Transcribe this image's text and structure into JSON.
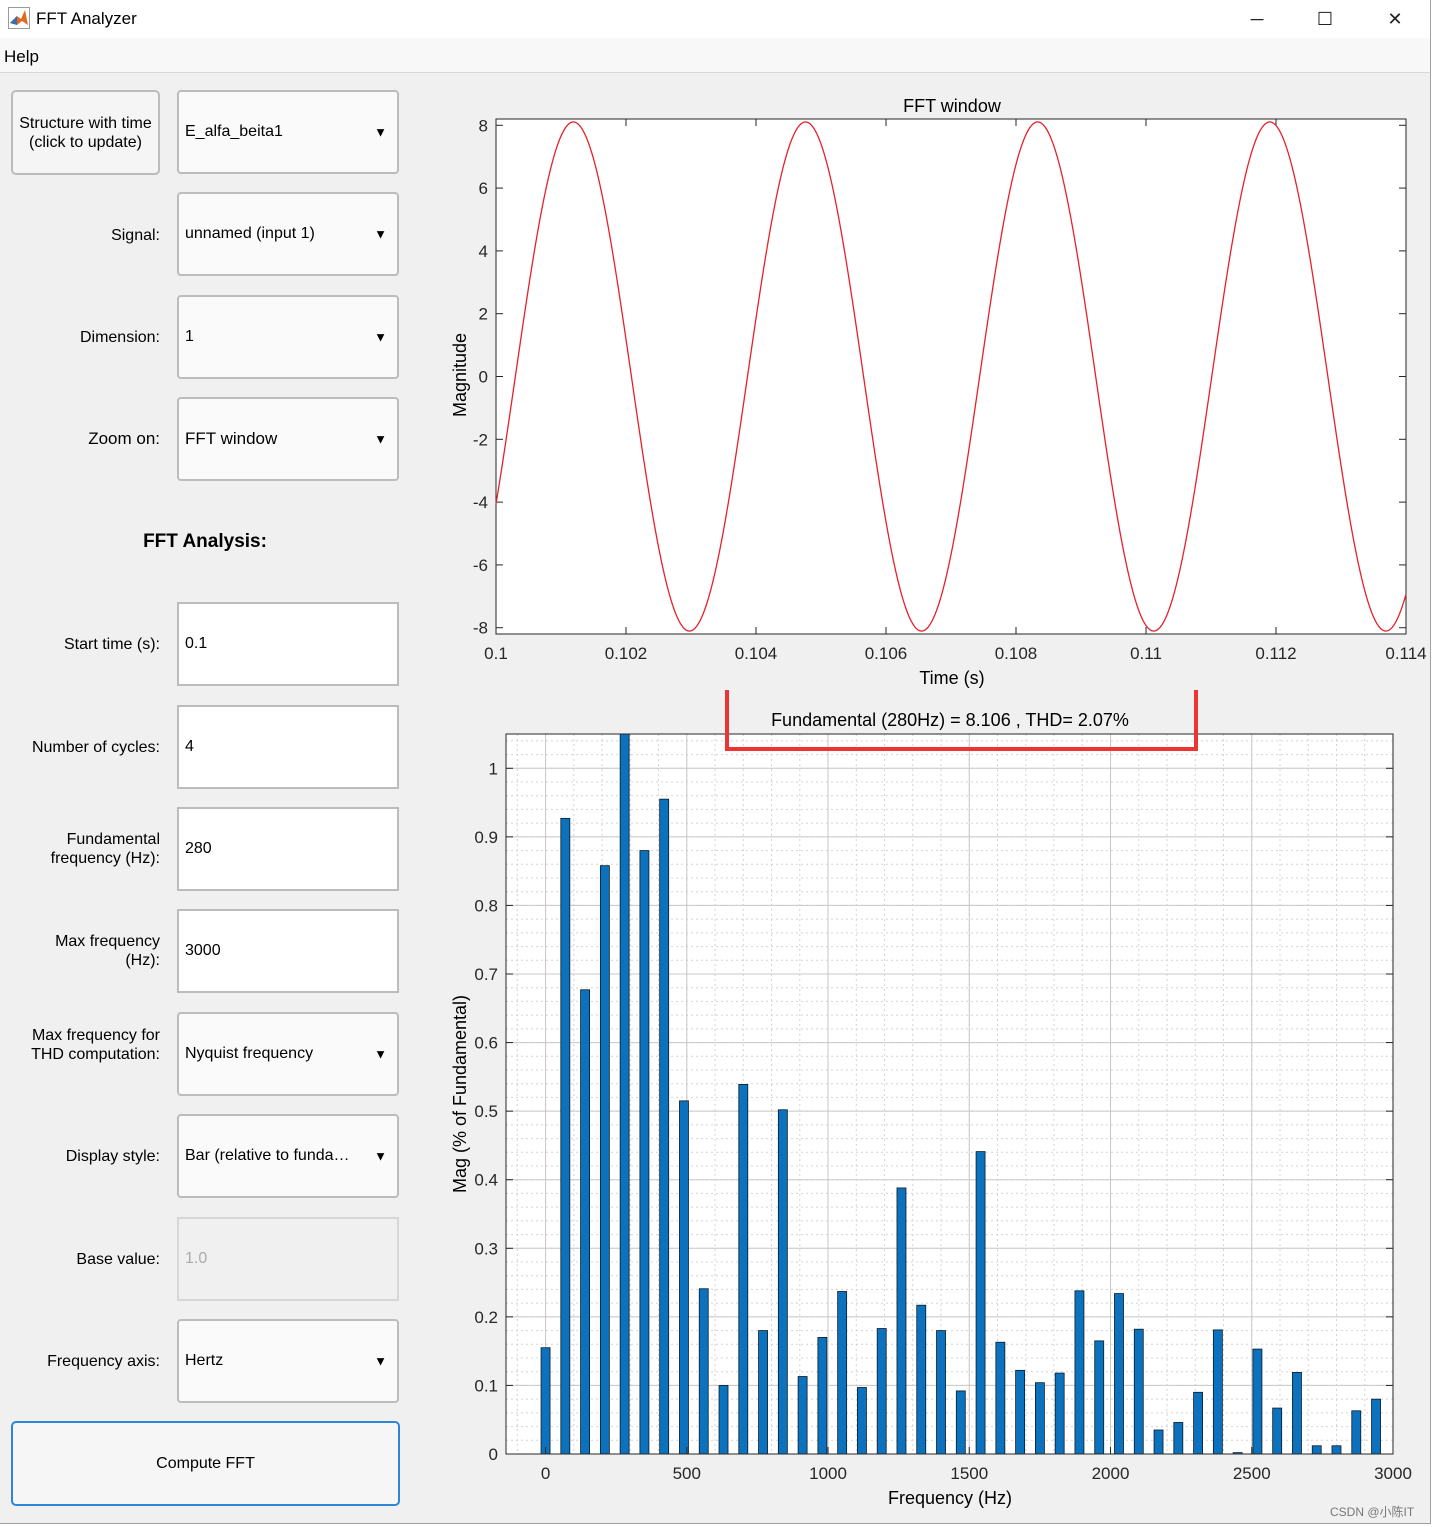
{
  "window": {
    "title": "FFT Analyzer",
    "minimize_glyph": "─",
    "maximize_glyph": "☐",
    "close_glyph": "✕",
    "icon": "matlab-icon"
  },
  "menu": {
    "help": "Help"
  },
  "controls": {
    "structure_button": "Structure with time (click to update)",
    "structure_value": "E_alfa_beita1",
    "signal_label": "Signal:",
    "signal_value": "unnamed (input 1)",
    "dimension_label": "Dimension:",
    "dimension_value": "1",
    "zoom_label": "Zoom on:",
    "zoom_value": "FFT window",
    "section_title": "FFT Analysis:",
    "start_time_label": "Start time (s):",
    "start_time_value": "0.1",
    "cycles_label": "Number of cycles:",
    "cycles_value": "4",
    "fund_label": "Fundamental frequency (Hz):",
    "fund_value": "280",
    "maxf_label": "Max frequency (Hz):",
    "maxf_value": "3000",
    "thd_label": "Max frequency for THD computation:",
    "thd_value": "Nyquist frequency",
    "display_label": "Display style:",
    "display_value": "Bar (relative to fundamental)",
    "base_label": "Base value:",
    "base_value": "1.0",
    "freqaxis_label": "Frequency axis:",
    "freqaxis_value": "Hertz",
    "compute_button": "Compute FFT",
    "dropdown_arrow": "▼"
  },
  "watermark": "CSDN @小陈IT",
  "colors": {
    "signal": "#e8202a",
    "bars": "#0d72bd",
    "highlight": "#ee3333"
  },
  "chart_data": [
    {
      "type": "line",
      "title": "FFT window",
      "xlabel": "Time (s)",
      "ylabel": "Magnitude",
      "xlim": [
        0.1,
        0.114
      ],
      "ylim": [
        -8.2,
        8.2
      ],
      "xticks": [
        "0.1",
        "0.102",
        "0.104",
        "0.106",
        "0.108",
        "0.11",
        "0.112",
        "0.114"
      ],
      "yticks": [
        "8",
        "6",
        "4",
        "2",
        "0",
        "-2",
        "-4",
        "-6",
        "-8"
      ],
      "series": [
        {
          "amplitude": 8.106,
          "frequency_hz": 280,
          "phase_deg": 240
        }
      ]
    },
    {
      "type": "bar",
      "title": "Fundamental (280Hz) = 8.106 , THD= 2.07%",
      "xlabel": "Frequency (Hz)",
      "ylabel": "Mag (% of Fundamental)",
      "xlim": [
        -140,
        3000
      ],
      "ylim": [
        0,
        1.05
      ],
      "xticks": [
        "0",
        "500",
        "1000",
        "1500",
        "2000",
        "2500",
        "3000"
      ],
      "yticks": [
        "0",
        "0.1",
        "0.2",
        "0.3",
        "0.4",
        "0.5",
        "0.6",
        "0.7",
        "0.8",
        "0.9",
        "1"
      ],
      "grid": true,
      "x": [
        0,
        70,
        140,
        210,
        280,
        350,
        420,
        490,
        560,
        630,
        700,
        770,
        840,
        910,
        980,
        1050,
        1120,
        1190,
        1260,
        1330,
        1400,
        1470,
        1540,
        1610,
        1680,
        1750,
        1820,
        1890,
        1960,
        2030,
        2100,
        2170,
        2240,
        2310,
        2380,
        2450,
        2520,
        2590,
        2660,
        2730,
        2800,
        2870,
        2940
      ],
      "values": [
        0.155,
        0.927,
        0.677,
        0.858,
        1.05,
        0.88,
        0.955,
        0.515,
        0.241,
        0.1,
        0.539,
        0.18,
        0.502,
        0.113,
        0.17,
        0.237,
        0.097,
        0.183,
        0.388,
        0.217,
        0.18,
        0.092,
        0.441,
        0.163,
        0.122,
        0.104,
        0.118,
        0.238,
        0.165,
        0.234,
        0.182,
        0.035,
        0.046,
        0.09,
        0.181,
        0.002,
        0.153,
        0.067,
        0.119,
        0.012,
        0.012,
        0.063,
        0.08
      ]
    }
  ]
}
